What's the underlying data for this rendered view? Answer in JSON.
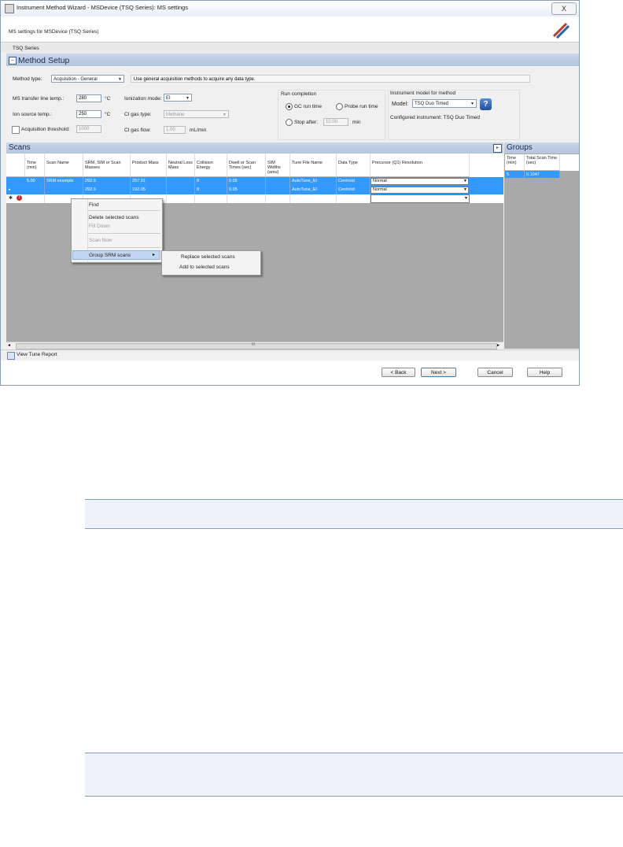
{
  "window": {
    "title": "Instrument Method Wizard - MSDevice (TSQ Series): MS settings",
    "close_label": "X",
    "header_text": "MS settings for MSDevice (TSQ Series)",
    "tab_label": "TSQ Series"
  },
  "method_setup": {
    "section_title": "Method Setup",
    "expand_glyph": "–",
    "method_type_label": "Method type:",
    "method_type_value": "Acquisition - General",
    "method_type_desc": "Use general acquisition methods to acquire any data type.",
    "transfer_line_label": "MS transfer line temp.:",
    "transfer_line_value": "280",
    "ion_source_label": "Ion source temp.:",
    "ion_source_value": "250",
    "temp_unit": "°C",
    "acq_threshold_label": "Acquisition threshold:",
    "acq_threshold_value": "1000",
    "ionization_label": "Ionization mode:",
    "ionization_value": "EI",
    "ci_gas_type_label": "CI gas type:",
    "ci_gas_type_value": "Methane",
    "ci_gas_flow_label": "CI gas flow:",
    "ci_gas_flow_value": "1.00",
    "ci_gas_flow_unit": "mL/min"
  },
  "run_completion": {
    "title": "Run completion",
    "gc_run_time": "GC run time",
    "probe_run_time": "Probe run time",
    "stop_after": "Stop after:",
    "stop_after_value": "10.00",
    "stop_after_unit": "min"
  },
  "instrument_model": {
    "title": "Instrument model for method",
    "model_label": "Model:",
    "model_value": "TSQ Duo Timed",
    "configured_text": "Configured instrument: TSQ Duo Timed"
  },
  "scans": {
    "title": "Scans",
    "columns": [
      "Time (min)",
      "Scan Name",
      "SRM, SIM or Scan Masses",
      "Product Mass",
      "Neutral Loss Mass",
      "Collision Energy",
      "Dwell or Scan Times (sec)",
      "SIM Widths (amu)",
      "Tune File Name",
      "Data Type",
      "Precursor (Q1) Resolution"
    ],
    "rows": [
      [
        "5.00",
        "SRM example",
        "292.9",
        "257.91",
        "",
        "8",
        "0.05",
        "",
        "AutoTune_EI",
        "Centroid",
        "Normal"
      ],
      [
        "",
        "",
        "292.9",
        "192.05",
        "",
        "8",
        "0.05",
        "",
        "AutoTune_EI",
        "Centroid",
        "Normal"
      ]
    ],
    "new_row_marker": "✱",
    "scroll_marker": "III"
  },
  "context_menu": {
    "items": [
      "Find",
      "Delete selected scans",
      "Fill Down",
      "Scan Now",
      "Group SRM scans"
    ],
    "submenu": [
      "Replace selected scans",
      "Add to selected scans"
    ]
  },
  "groups": {
    "title": "Groups",
    "columns": [
      "Time (min)",
      "Total Scan Time (sec)"
    ],
    "rows": [
      [
        "5",
        "0.1047"
      ]
    ]
  },
  "footer": {
    "view_tune_report": "View Tune Report",
    "back": "< Back",
    "next": "Next >",
    "cancel": "Cancel",
    "help": "Help"
  },
  "colors": {
    "selection": "#3399ff",
    "section_header": "#c9d6ea",
    "grid_background": "#a9a9a9"
  }
}
